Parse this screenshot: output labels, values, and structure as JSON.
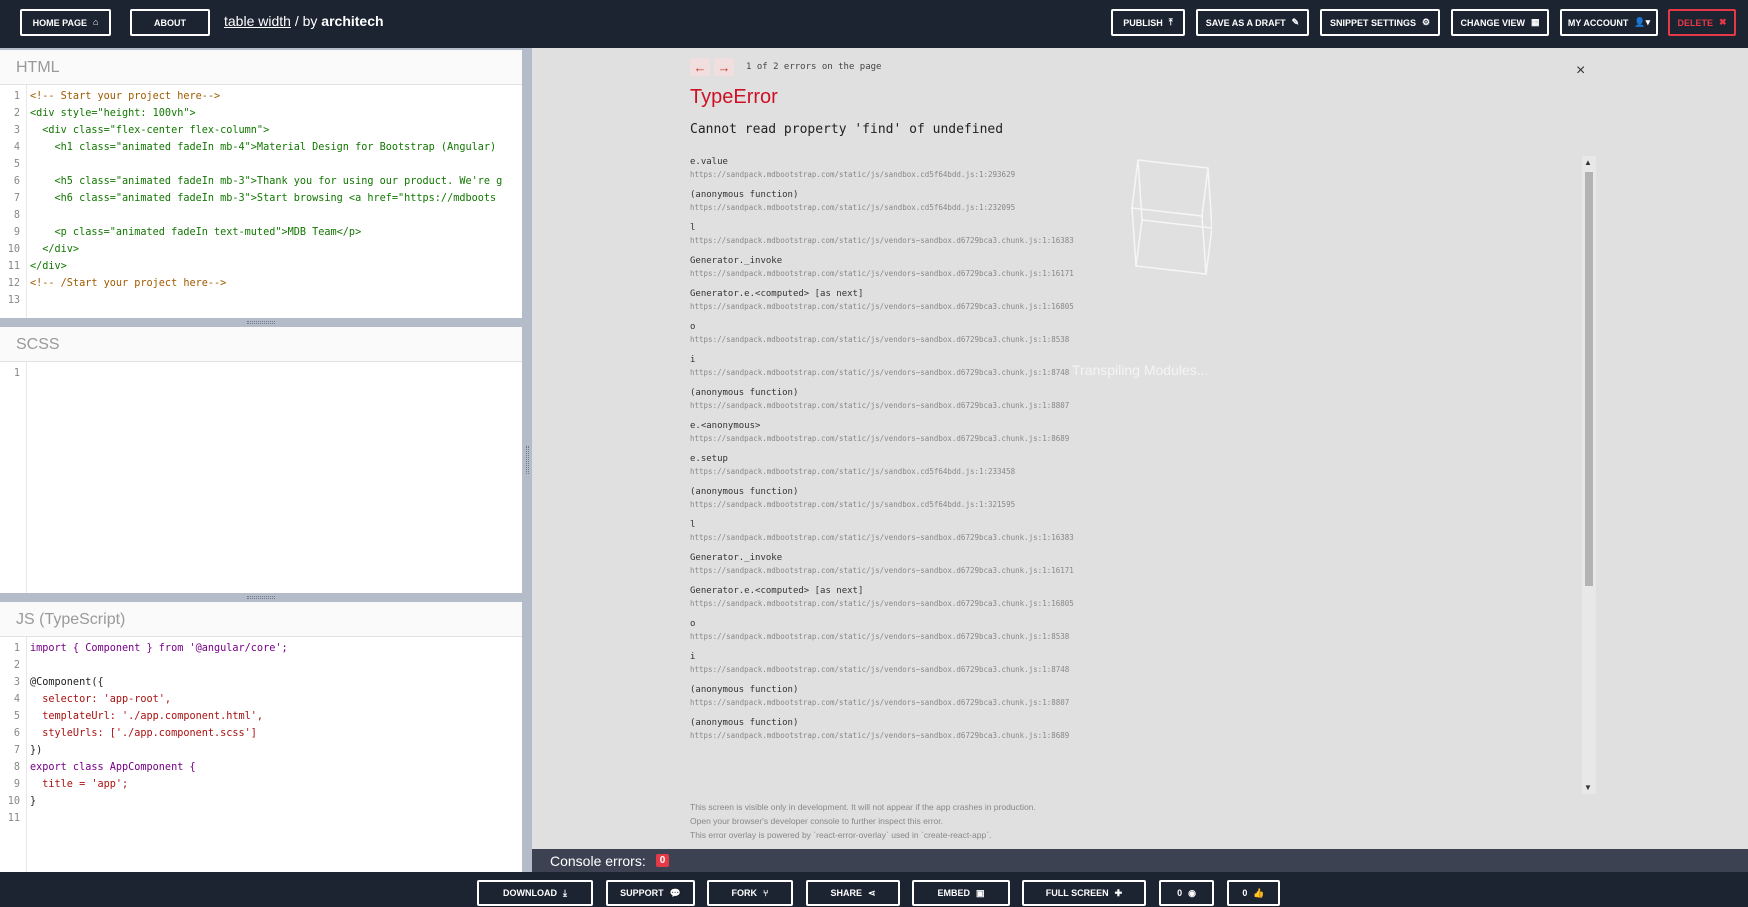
{
  "topbar": {
    "home_label": "HOME PAGE",
    "home_icon": "home-icon",
    "about_label": "ABOUT",
    "project_name": "table width",
    "by_text": " / by ",
    "author": "architech",
    "publish_label": "PUBLISH",
    "save_draft_label": "SAVE AS A DRAFT",
    "snippet_settings_label": "SNIPPET SETTINGS",
    "change_view_label": "CHANGE VIEW",
    "my_account_label": "MY ACCOUNT",
    "delete_label": "DELETE",
    "delete_color": "#e53948"
  },
  "editors": {
    "html": {
      "title": "HTML",
      "lines": [
        "<!-- Start your project here-->",
        "<div style=\"height: 100vh\">",
        "  <div class=\"flex-center flex-column\">",
        "    <h1 class=\"animated fadeIn mb-4\">Material Design for Bootstrap (Angular)",
        "",
        "    <h5 class=\"animated fadeIn mb-3\">Thank you for using our product. We're g",
        "    <h6 class=\"animated fadeIn mb-3\">Start browsing <a href=\"https://mdboots",
        "",
        "    <p class=\"animated fadeIn text-muted\">MDB Team</p>",
        "  </div>",
        "</div>",
        "<!-- /Start your project here-->",
        ""
      ]
    },
    "scss": {
      "title": "SCSS",
      "lines": [
        ""
      ]
    },
    "ts": {
      "title": "JS (TypeScript)",
      "lines": [
        "import { Component } from '@angular/core';",
        "",
        "@Component({",
        "  selector: 'app-root',",
        "  templateUrl: './app.component.html',",
        "  styleUrls: ['./app.component.scss']",
        "})",
        "export class AppComponent {",
        "  title = 'app';",
        "}",
        ""
      ]
    }
  },
  "error_overlay": {
    "prev_label": "←",
    "next_label": "→",
    "count_text": "1 of 2 errors on the page",
    "close_label": "×",
    "error_type": "TypeError",
    "error_message": "Cannot read property 'find' of undefined",
    "stack": [
      {
        "fn": "e.value",
        "url": "https://sandpack.mdbootstrap.com/static/js/sandbox.cd5f64bdd.js:1:293629"
      },
      {
        "fn": "(anonymous function)",
        "url": "https://sandpack.mdbootstrap.com/static/js/sandbox.cd5f64bdd.js:1:232095"
      },
      {
        "fn": "l",
        "url": "https://sandpack.mdbootstrap.com/static/js/vendors~sandbox.d6729bca3.chunk.js:1:16383"
      },
      {
        "fn": "Generator._invoke",
        "url": "https://sandpack.mdbootstrap.com/static/js/vendors~sandbox.d6729bca3.chunk.js:1:16171"
      },
      {
        "fn": "Generator.e.<computed> [as next]",
        "url": "https://sandpack.mdbootstrap.com/static/js/vendors~sandbox.d6729bca3.chunk.js:1:16805"
      },
      {
        "fn": "o",
        "url": "https://sandpack.mdbootstrap.com/static/js/vendors~sandbox.d6729bca3.chunk.js:1:8538"
      },
      {
        "fn": "i",
        "url": "https://sandpack.mdbootstrap.com/static/js/vendors~sandbox.d6729bca3.chunk.js:1:8748"
      },
      {
        "fn": "(anonymous function)",
        "url": "https://sandpack.mdbootstrap.com/static/js/vendors~sandbox.d6729bca3.chunk.js:1:8807"
      },
      {
        "fn": "e.<anonymous>",
        "url": "https://sandpack.mdbootstrap.com/static/js/vendors~sandbox.d6729bca3.chunk.js:1:8689"
      },
      {
        "fn": "e.setup",
        "url": "https://sandpack.mdbootstrap.com/static/js/sandbox.cd5f64bdd.js:1:233458"
      },
      {
        "fn": "(anonymous function)",
        "url": "https://sandpack.mdbootstrap.com/static/js/sandbox.cd5f64bdd.js:1:321595"
      },
      {
        "fn": "l",
        "url": "https://sandpack.mdbootstrap.com/static/js/vendors~sandbox.d6729bca3.chunk.js:1:16383"
      },
      {
        "fn": "Generator._invoke",
        "url": "https://sandpack.mdbootstrap.com/static/js/vendors~sandbox.d6729bca3.chunk.js:1:16171"
      },
      {
        "fn": "Generator.e.<computed> [as next]",
        "url": "https://sandpack.mdbootstrap.com/static/js/vendors~sandbox.d6729bca3.chunk.js:1:16805"
      },
      {
        "fn": "o",
        "url": "https://sandpack.mdbootstrap.com/static/js/vendors~sandbox.d6729bca3.chunk.js:1:8538"
      },
      {
        "fn": "i",
        "url": "https://sandpack.mdbootstrap.com/static/js/vendors~sandbox.d6729bca3.chunk.js:1:8748"
      },
      {
        "fn": "(anonymous function)",
        "url": "https://sandpack.mdbootstrap.com/static/js/vendors~sandbox.d6729bca3.chunk.js:1:8807"
      },
      {
        "fn": "(anonymous function)",
        "url": "https://sandpack.mdbootstrap.com/static/js/vendors~sandbox.d6729bca3.chunk.js:1:8689"
      }
    ],
    "transpiling_text": "Transpiling Modules...",
    "footnotes": [
      "This screen is visible only in development. It will not appear if the app crashes in production.",
      "Open your browser's developer console to further inspect this error.",
      "This error overlay is powered by `react-error-overlay` used in `create-react-app`."
    ],
    "error_color": "#ce1126"
  },
  "console": {
    "label": "Console errors:",
    "count": "0"
  },
  "bottombar": {
    "download_label": "DOWNLOAD",
    "support_label": "SUPPORT",
    "fork_label": "FORK",
    "share_label": "SHARE",
    "embed_label": "EMBED",
    "fullscreen_label": "FULL SCREEN",
    "views_count": "0",
    "likes_count": "0"
  }
}
